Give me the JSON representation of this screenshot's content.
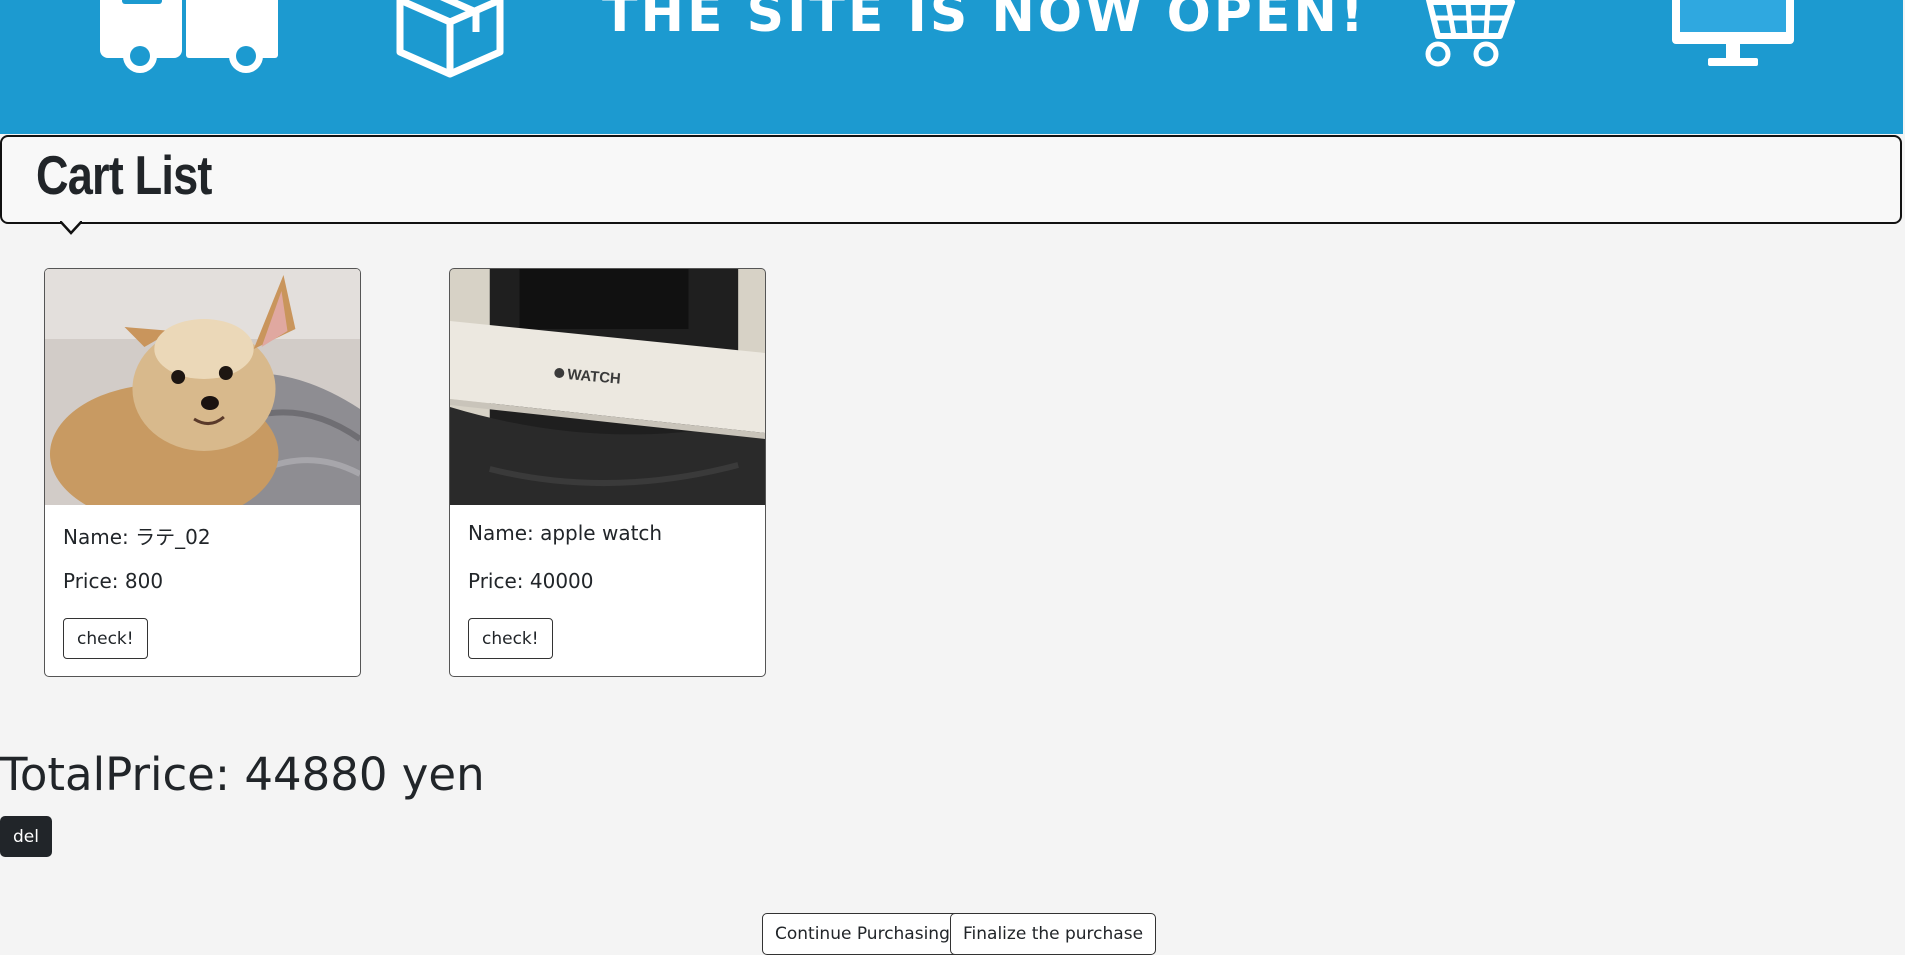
{
  "banner": {
    "text": "THE SITE IS NOW OPEN!",
    "background_color": "#1c9ad0",
    "icons": [
      "truck-icon",
      "box-icon",
      "cart-icon",
      "monitor-icon"
    ]
  },
  "heading": {
    "title": "Cart List"
  },
  "cart": {
    "items": [
      {
        "image": "dog-photo",
        "name": "Name: ラテ_02",
        "price": "Price: 800",
        "button_label": "check!"
      },
      {
        "image": "apple-watch-box-photo",
        "image_text": "WATCH",
        "name": "Name: apple watch",
        "price": "Price: 40000",
        "button_label": "check!"
      }
    ]
  },
  "summary": {
    "total": "TotalPrice: 44880 yen",
    "del_label": "del"
  },
  "actions": {
    "continue_label": "Continue Purchasing",
    "finalize_label": "Finalize the purchase"
  }
}
